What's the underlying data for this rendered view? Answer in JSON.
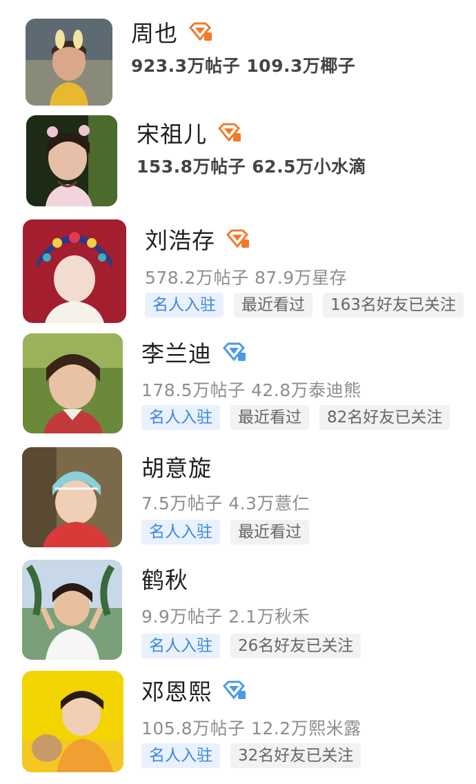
{
  "accounts": [
    {
      "name": "周也",
      "badge_icon": "orange-gem-badge-icon",
      "badge_color": "#f07a2a",
      "stats": "923.3万帖子 109.3万椰子",
      "tags": []
    },
    {
      "name": "宋祖儿",
      "badge_icon": "orange-gem-badge-icon",
      "badge_color": "#f07a2a",
      "stats": "153.8万帖子 62.5万小水滴",
      "tags": []
    },
    {
      "name": "刘浩存",
      "badge_icon": "orange-gem-badge-icon",
      "badge_color": "#f07a2a",
      "stats": "578.2万帖子 87.9万星存",
      "tags": [
        "名人入驻",
        "最近看过",
        "163名好友已关注"
      ]
    },
    {
      "name": "李兰迪",
      "badge_icon": "blue-gem-badge-icon",
      "badge_color": "#4a9ae6",
      "stats": "178.5万帖子 42.8万泰迪熊",
      "tags": [
        "名人入驻",
        "最近看过",
        "82名好友已关注"
      ]
    },
    {
      "name": "胡意旋",
      "badge_icon": "",
      "badge_color": "",
      "stats": "7.5万帖子 4.3万薏仁",
      "tags": [
        "名人入驻",
        "最近看过"
      ]
    },
    {
      "name": "鹤秋",
      "badge_icon": "",
      "badge_color": "",
      "stats": "9.9万帖子 2.1万秋禾",
      "tags": [
        "名人入驻",
        "26名好友已关注"
      ]
    },
    {
      "name": "邓恩熙",
      "badge_icon": "blue-gem-badge-icon",
      "badge_color": "#4a9ae6",
      "stats": "105.8万帖子 12.2万熙米露",
      "tags": [
        "名人入驻",
        "32名好友已关注"
      ]
    }
  ],
  "theme": {
    "celebrity_tag_color": "#3d87d8",
    "celebrity_tag_bg": "#e8f1fd",
    "plain_tag_bg": "#f2f2f2"
  }
}
